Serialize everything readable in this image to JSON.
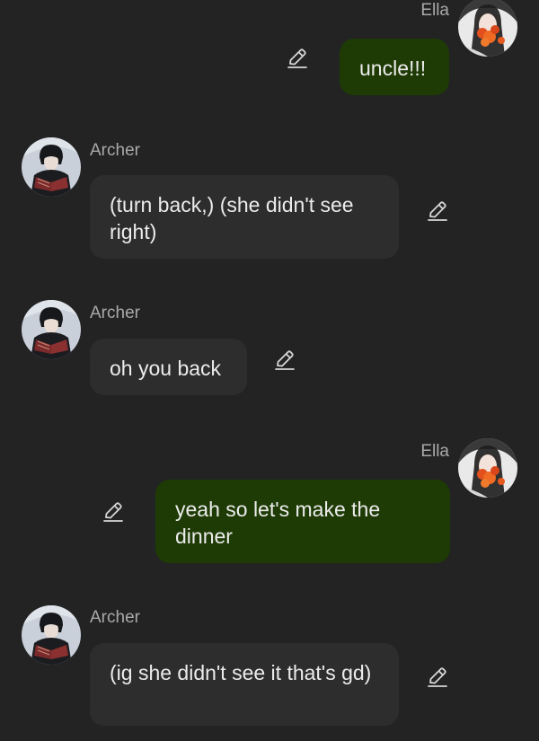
{
  "messages": [
    {
      "sender": "Ella",
      "text": "uncle!!!",
      "side": "right"
    },
    {
      "sender": "Archer",
      "text": "(turn back,) (she didn't see right)",
      "side": "left"
    },
    {
      "sender": "Archer",
      "text": "oh you back",
      "side": "left"
    },
    {
      "sender": "Ella",
      "text": "yeah so let's make the dinner",
      "side": "right"
    },
    {
      "sender": "Archer",
      "text": "(ig she didn't see it that's gd)",
      "side": "left"
    }
  ],
  "colors": {
    "background": "#232323",
    "incoming_bubble": "#2d2d2d",
    "outgoing_bubble": "#1e3b05",
    "name_text": "#a9a9a9",
    "message_text": "#ececec"
  },
  "icons": {
    "edit": "pencil-icon"
  }
}
